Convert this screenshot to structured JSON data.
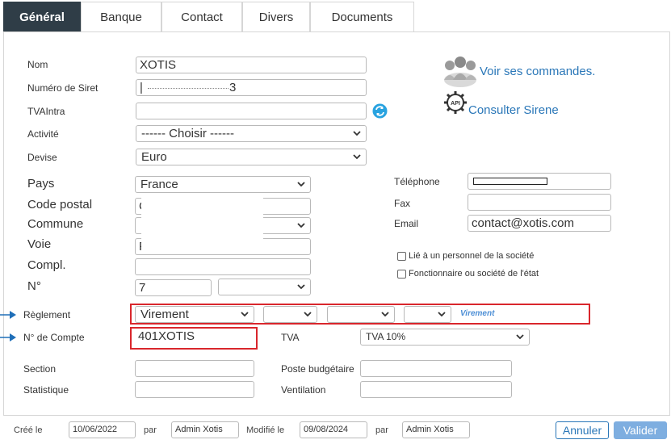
{
  "tabs": [
    {
      "label": "Général",
      "active": true
    },
    {
      "label": "Banque"
    },
    {
      "label": "Contact"
    },
    {
      "label": "Divers"
    },
    {
      "label": "Documents"
    }
  ],
  "form": {
    "nom_label": "Nom",
    "nom_value": "XOTIS",
    "siret_label": "Numéro de Siret",
    "siret_value": "3",
    "tva_intra_label": "TVAIntra",
    "tva_intra_value": "",
    "activite_label": "Activité",
    "activite_value": "------ Choisir ------",
    "devise_label": "Devise",
    "devise_value": "Euro",
    "pays_label": "Pays",
    "pays_value": "France",
    "cp_label": "Code postal",
    "cp_value": "C",
    "commune_label": "Commune",
    "commune_value": "",
    "voie_label": "Voie",
    "voie_value": "F",
    "compl_label": "Compl.",
    "compl_value": "",
    "numero_label": "N°",
    "numero_value": "7",
    "numero_suffix_value": ""
  },
  "contact": {
    "tel_label": "Téléphone",
    "tel_value": "",
    "fax_label": "Fax",
    "fax_value": "",
    "email_label": "Email",
    "email_value": "contact@xotis.com",
    "lie_label": "Lié à un personnel de la société",
    "fonctionnaire_label": "Fonctionnaire ou société de l'état"
  },
  "links": {
    "commandes": "Voir ses commandes.",
    "sirene": "Consulter Sirene",
    "sirene_icon_text": "API"
  },
  "reglement": {
    "label": "Règlement",
    "value": "Virement",
    "extra1": "",
    "extra2": "",
    "extra3": "",
    "hint": "Virement"
  },
  "compte": {
    "label": "N° de Compte",
    "value": "401XOTIS",
    "tva_label": "TVA",
    "tva_value": "TVA 10%"
  },
  "analytique": {
    "section_label": "Section",
    "section_value": "",
    "poste_label": "Poste budgétaire",
    "poste_value": "",
    "statistique_label": "Statistique",
    "statistique_value": "",
    "ventilation_label": "Ventilation",
    "ventilation_value": ""
  },
  "footer": {
    "cree_label": "Créé le",
    "cree_value": "10/06/2022",
    "par1_label": "par",
    "par1_value": "Admin Xotis",
    "modifie_label": "Modifié le",
    "modifie_value": "09/08/2024",
    "par2_label": "par",
    "par2_value": "Admin Xotis",
    "annuler": "Annuler",
    "valider": "Valider"
  },
  "colors": {
    "active_tab": "#2f3d47",
    "highlight": "#d9262c",
    "link": "#2a77b8",
    "arrow": "#1f6fb8",
    "valider": "#7eaee0"
  }
}
